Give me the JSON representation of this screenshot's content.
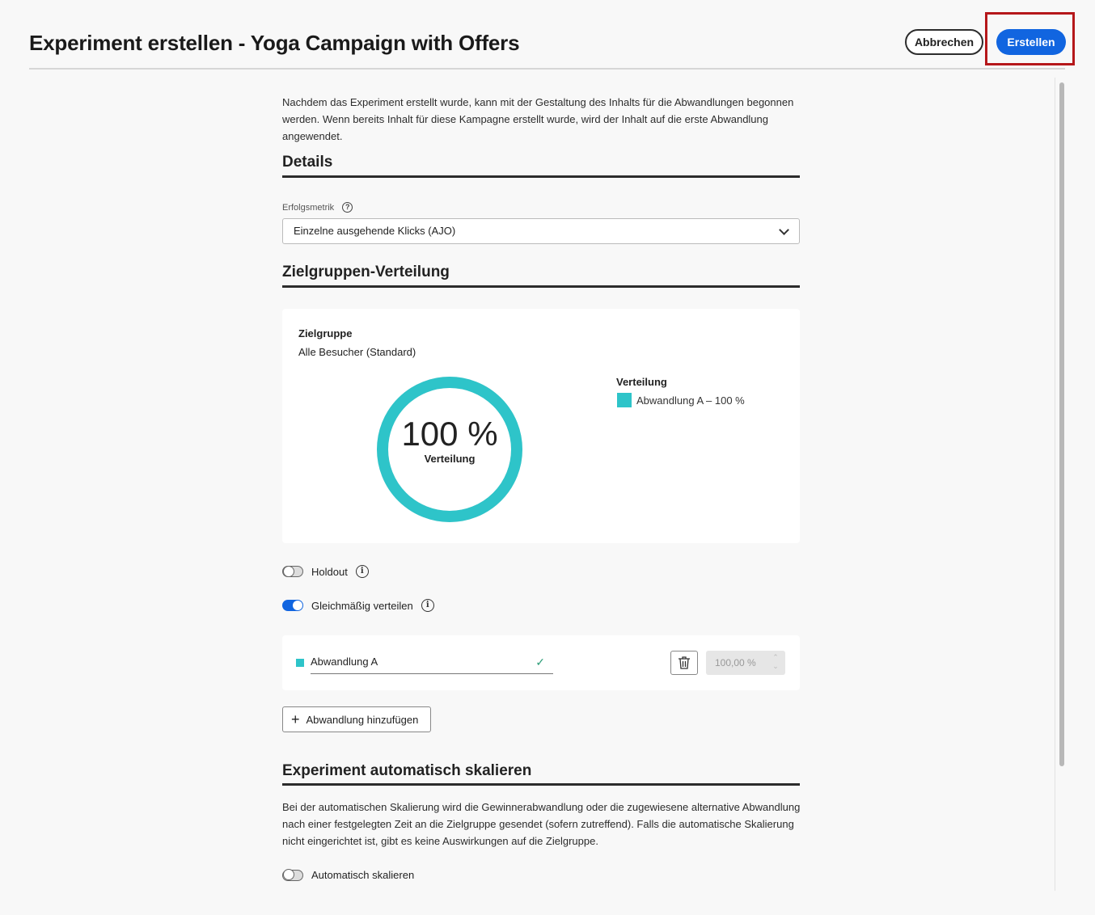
{
  "header": {
    "title": "Experiment erstellen - Yoga Campaign with Offers",
    "cancel_label": "Abbrechen",
    "create_label": "Erstellen"
  },
  "intro": "Nachdem das Experiment erstellt wurde, kann mit der Gestaltung des Inhalts für die Abwandlungen begonnen werden. Wenn bereits Inhalt für diese Kampagne erstellt wurde, wird der Inhalt auf die erste Abwandlung angewendet.",
  "details": {
    "title": "Details",
    "metric_label": "Erfolgsmetrik",
    "metric_value": "Einzelne ausgehende Klicks (AJO)"
  },
  "distribution": {
    "title": "Zielgruppen-Verteilung",
    "audience_label": "Zielgruppe",
    "audience_value": "Alle Besucher (Standard)",
    "donut_value": "100 %",
    "donut_caption": "Verteilung",
    "donut_fraction": 1.0,
    "legend_title": "Verteilung",
    "legend_item": "Abwandlung A – 100 %",
    "accent_color": "#2ec4c9"
  },
  "toggles": {
    "holdout_label": "Holdout",
    "holdout_on": false,
    "even_label": "Gleichmäßig verteilen",
    "even_on": true
  },
  "variant": {
    "name": "Abwandlung A",
    "percent": "100,00 %"
  },
  "add_variant_label": "Abwandlung hinzufügen",
  "autoscale": {
    "title": "Experiment automatisch skalieren",
    "description": "Bei der automatischen Skalierung wird die Gewinnerabwandlung oder die zugewiesene alternative Abwandlung nach einer festgelegten Zeit an die Zielgruppe gesendet (sofern zutreffend). Falls die automatische Skalierung nicht eingerichtet ist, gibt es keine Auswirkungen auf die Zielgruppe.",
    "toggle_label": "Automatisch skalieren",
    "toggle_on": false
  },
  "colors": {
    "primary": "#1165e0",
    "highlight": "#b5171a"
  }
}
